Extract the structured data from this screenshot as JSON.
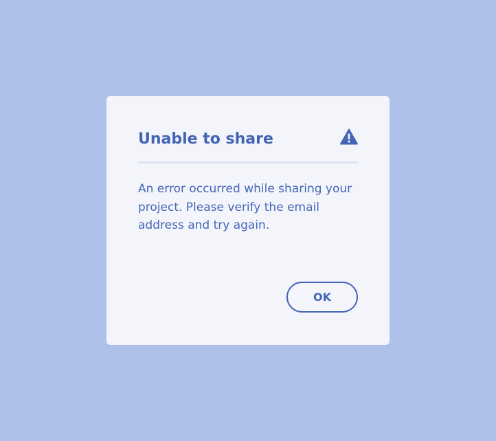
{
  "dialog": {
    "title": "Unable to share",
    "icon": "alert-triangle-icon",
    "message": "An error occurred while sharing your project. Please verify the email address and try again.",
    "ok_label": "OK"
  },
  "colors": {
    "backdrop": "#aec1e8",
    "dialog_background": "#f4f5fb",
    "accent": "#4466b6",
    "divider": "#dbe3f4"
  }
}
